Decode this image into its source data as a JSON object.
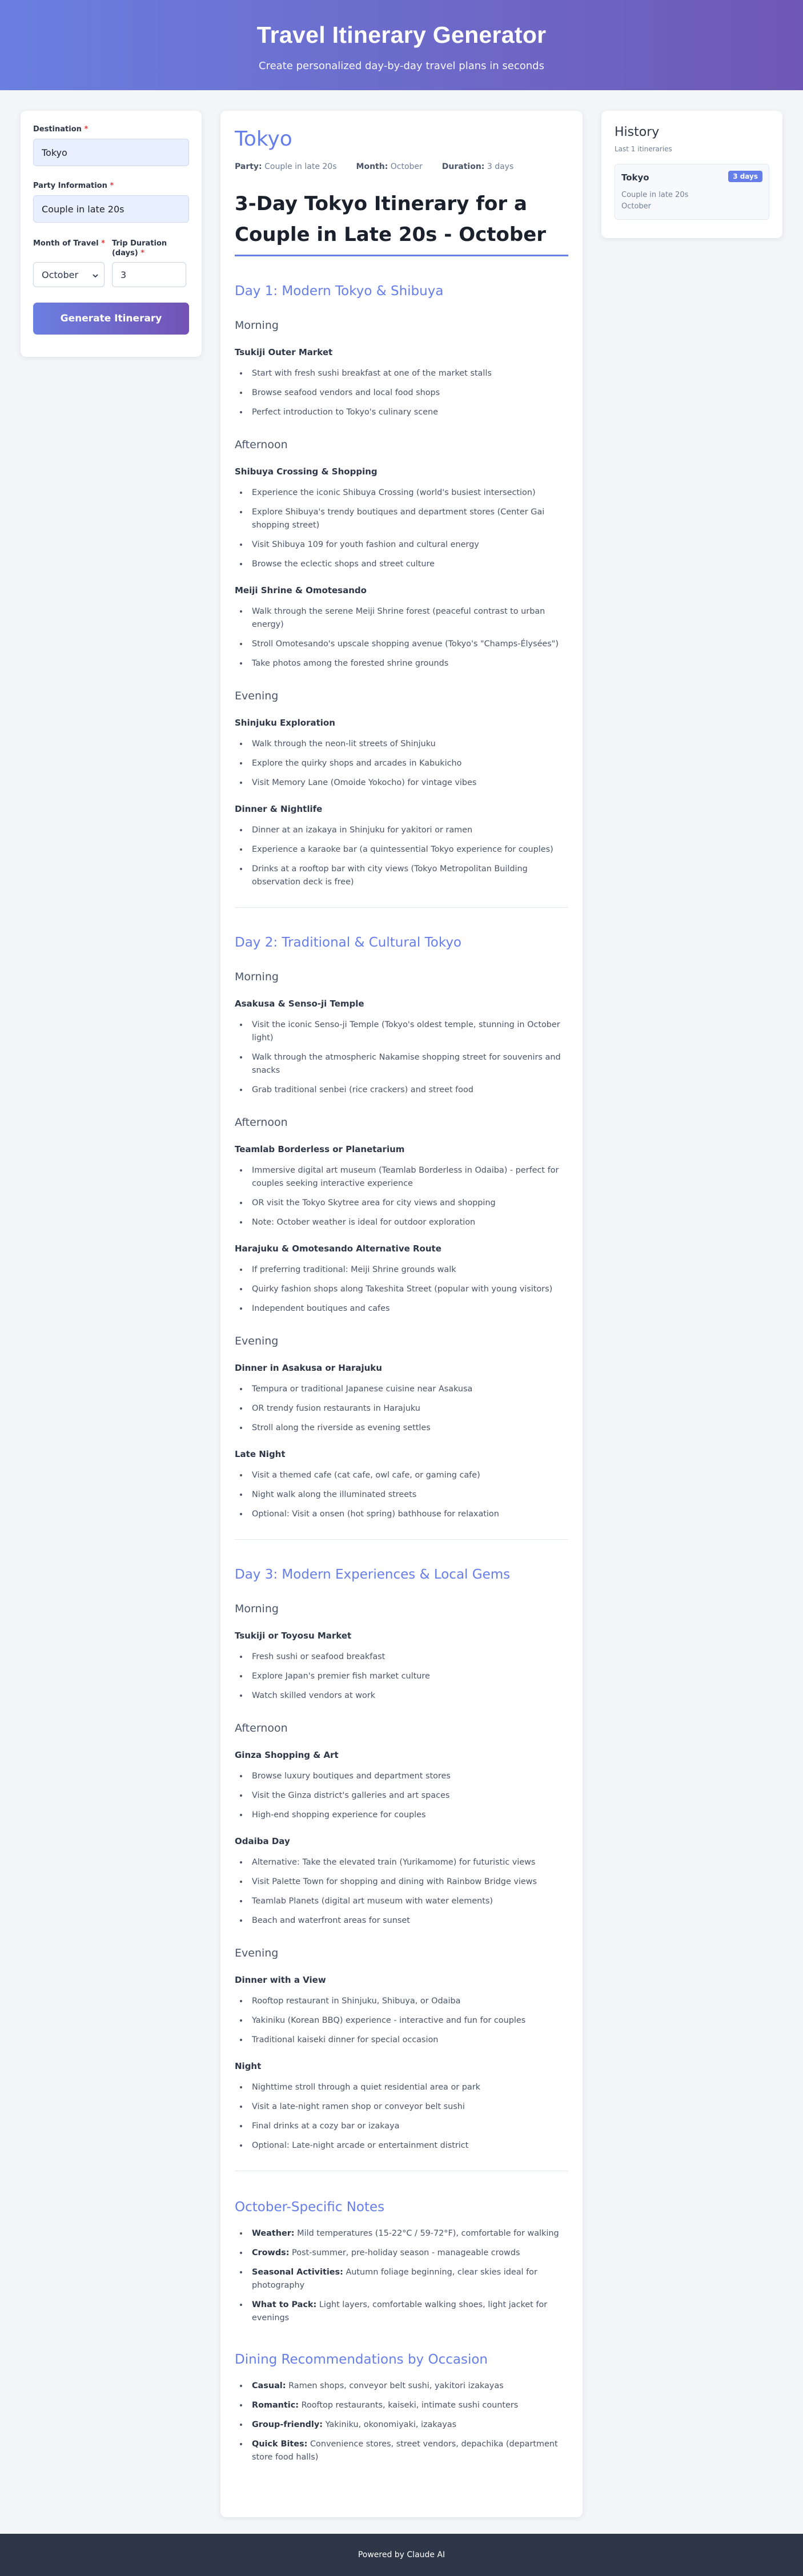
{
  "header": {
    "title": "Travel Itinerary Generator",
    "subtitle": "Create personalized day-by-day travel plans in seconds"
  },
  "form": {
    "destination_label": "Destination",
    "destination_value": "Tokyo",
    "party_label": "Party Information",
    "party_value": "Couple in late 20s",
    "month_label": "Month of Travel",
    "month_value": "October",
    "duration_label": "Trip Duration (days)",
    "duration_value": "3",
    "required_mark": "*",
    "generate_label": "Generate Itinerary"
  },
  "result": {
    "city": "Tokyo",
    "meta": [
      {
        "key": "Party:",
        "value": "Couple in late 20s"
      },
      {
        "key": "Month:",
        "value": "October"
      },
      {
        "key": "Duration:",
        "value": "3 days"
      }
    ],
    "title": "3-Day Tokyo Itinerary for a Couple in Late 20s - October",
    "days": [
      {
        "title": "Day 1: Modern Tokyo & Shibuya",
        "periods": [
          {
            "name": "Morning",
            "activities": [
              {
                "name": "Tsukiji Outer Market",
                "items": [
                  "Start with fresh sushi breakfast at one of the market stalls",
                  "Browse seafood vendors and local food shops",
                  "Perfect introduction to Tokyo's culinary scene"
                ]
              }
            ]
          },
          {
            "name": "Afternoon",
            "activities": [
              {
                "name": "Shibuya Crossing & Shopping",
                "items": [
                  "Experience the iconic Shibuya Crossing (world's busiest intersection)",
                  "Explore Shibuya's trendy boutiques and department stores (Center Gai shopping street)",
                  "Visit Shibuya 109 for youth fashion and cultural energy",
                  "Browse the eclectic shops and street culture"
                ]
              },
              {
                "name": "Meiji Shrine & Omotesando",
                "items": [
                  "Walk through the serene Meiji Shrine forest (peaceful contrast to urban energy)",
                  "Stroll Omotesando's upscale shopping avenue (Tokyo's \"Champs-Élysées\")",
                  "Take photos among the forested shrine grounds"
                ]
              }
            ]
          },
          {
            "name": "Evening",
            "activities": [
              {
                "name": "Shinjuku Exploration",
                "items": [
                  "Walk through the neon-lit streets of Shinjuku",
                  "Explore the quirky shops and arcades in Kabukicho",
                  "Visit Memory Lane (Omoide Yokocho) for vintage vibes"
                ]
              },
              {
                "name": "Dinner & Nightlife",
                "items": [
                  "Dinner at an izakaya in Shinjuku for yakitori or ramen",
                  "Experience a karaoke bar (a quintessential Tokyo experience for couples)",
                  "Drinks at a rooftop bar with city views (Tokyo Metropolitan Building observation deck is free)"
                ]
              }
            ]
          }
        ]
      },
      {
        "title": "Day 2: Traditional & Cultural Tokyo",
        "periods": [
          {
            "name": "Morning",
            "activities": [
              {
                "name": "Asakusa & Senso-ji Temple",
                "items": [
                  "Visit the iconic Senso-ji Temple (Tokyo's oldest temple, stunning in October light)",
                  "Walk through the atmospheric Nakamise shopping street for souvenirs and snacks",
                  "Grab traditional senbei (rice crackers) and street food"
                ]
              }
            ]
          },
          {
            "name": "Afternoon",
            "activities": [
              {
                "name": "Teamlab Borderless or Planetarium",
                "items": [
                  "Immersive digital art museum (Teamlab Borderless in Odaiba) - perfect for couples seeking interactive experience",
                  "OR visit the Tokyo Skytree area for city views and shopping",
                  "Note: October weather is ideal for outdoor exploration"
                ]
              },
              {
                "name": "Harajuku & Omotesando Alternative Route",
                "items": [
                  "If preferring traditional: Meiji Shrine grounds walk",
                  "Quirky fashion shops along Takeshita Street (popular with young visitors)",
                  "Independent boutiques and cafes"
                ]
              }
            ]
          },
          {
            "name": "Evening",
            "activities": [
              {
                "name": "Dinner in Asakusa or Harajuku",
                "items": [
                  "Tempura or traditional Japanese cuisine near Asakusa",
                  "OR trendy fusion restaurants in Harajuku",
                  "Stroll along the riverside as evening settles"
                ]
              },
              {
                "name": "Late Night",
                "items": [
                  "Visit a themed cafe (cat cafe, owl cafe, or gaming cafe)",
                  "Night walk along the illuminated streets",
                  "Optional: Visit a onsen (hot spring) bathhouse for relaxation"
                ]
              }
            ]
          }
        ]
      },
      {
        "title": "Day 3: Modern Experiences & Local Gems",
        "periods": [
          {
            "name": "Morning",
            "activities": [
              {
                "name": "Tsukiji or Toyosu Market",
                "items": [
                  "Fresh sushi or seafood breakfast",
                  "Explore Japan's premier fish market culture",
                  "Watch skilled vendors at work"
                ]
              }
            ]
          },
          {
            "name": "Afternoon",
            "activities": [
              {
                "name": "Ginza Shopping & Art",
                "items": [
                  "Browse luxury boutiques and department stores",
                  "Visit the Ginza district's galleries and art spaces",
                  "High-end shopping experience for couples"
                ]
              },
              {
                "name": "Odaiba Day",
                "items": [
                  "Alternative: Take the elevated train (Yurikamome) for futuristic views",
                  "Visit Palette Town for shopping and dining with Rainbow Bridge views",
                  "Teamlab Planets (digital art museum with water elements)",
                  "Beach and waterfront areas for sunset"
                ]
              }
            ]
          },
          {
            "name": "Evening",
            "activities": [
              {
                "name": "Dinner with a View",
                "items": [
                  "Rooftop restaurant in Shinjuku, Shibuya, or Odaiba",
                  "Yakiniku (Korean BBQ) experience - interactive and fun for couples",
                  "Traditional kaiseki dinner for special occasion"
                ]
              },
              {
                "name": "Night",
                "items": [
                  "Nighttime stroll through a quiet residential area or park",
                  "Visit a late-night ramen shop or conveyor belt sushi",
                  "Final drinks at a cozy bar or izakaya",
                  "Optional: Late-night arcade or entertainment district"
                ]
              }
            ]
          }
        ]
      }
    ],
    "notes_title": "October-Specific Notes",
    "notes": [
      {
        "key": "Weather:",
        "value": "Mild temperatures (15-22°C / 59-72°F), comfortable for walking"
      },
      {
        "key": "Crowds:",
        "value": "Post-summer, pre-holiday season - manageable crowds"
      },
      {
        "key": "Seasonal Activities:",
        "value": "Autumn foliage beginning, clear skies ideal for photography"
      },
      {
        "key": "What to Pack:",
        "value": "Light layers, comfortable walking shoes, light jacket for evenings"
      }
    ],
    "dining_title": "Dining Recommendations by Occasion",
    "dining": [
      {
        "key": "Casual:",
        "value": "Ramen shops, conveyor belt sushi, yakitori izakayas"
      },
      {
        "key": "Romantic:",
        "value": "Rooftop restaurants, kaiseki, intimate sushi counters"
      },
      {
        "key": "Group-friendly:",
        "value": "Yakiniku, okonomiyaki, izakayas"
      },
      {
        "key": "Quick Bites:",
        "value": "Convenience stores, street vendors, depachika (department store food halls)"
      }
    ]
  },
  "history": {
    "title": "History",
    "subtitle": "Last 1 itineraries",
    "items": [
      {
        "destination": "Tokyo",
        "badge": "3 days",
        "party": "Couple in late 20s",
        "month": "October"
      }
    ]
  },
  "footer": {
    "text": "Powered by Claude AI"
  }
}
